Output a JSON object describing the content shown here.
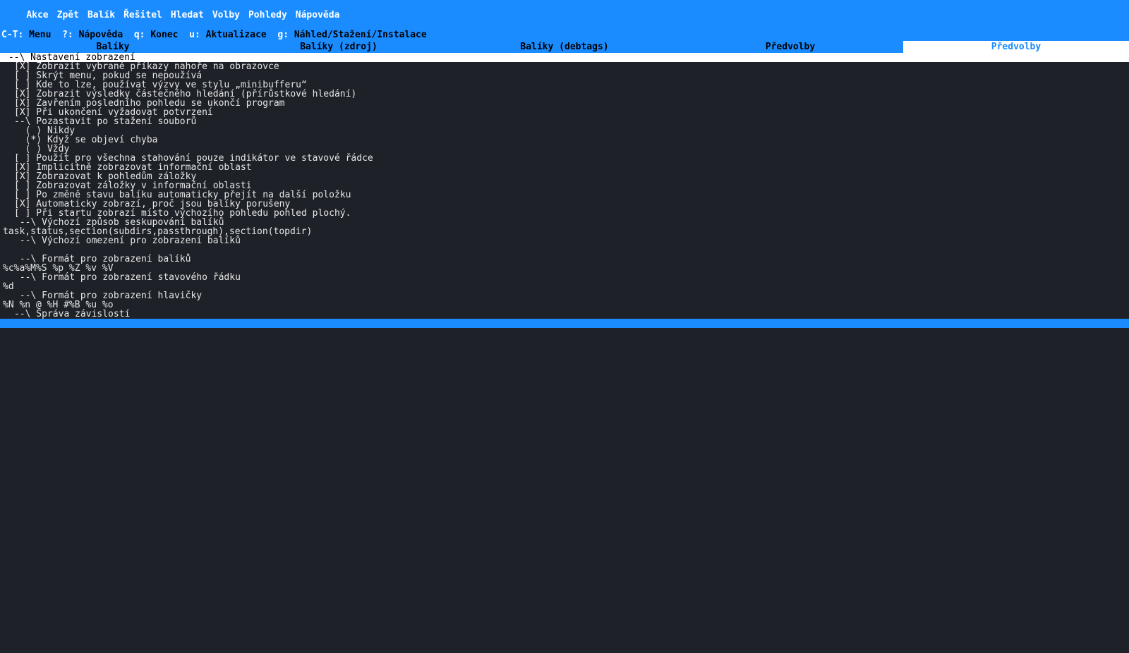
{
  "menubar": {
    "items": [
      "Akce",
      "Zpět",
      "Balík",
      "Řešitel",
      "Hledat",
      "Volby",
      "Pohledy",
      "Nápověda"
    ]
  },
  "shortcuts": {
    "parts": [
      {
        "k": "C-T:",
        "v": "Menu"
      },
      {
        "k": "?:",
        "v": "Nápověda"
      },
      {
        "k": "q:",
        "v": "Konec"
      },
      {
        "k": "u:",
        "v": "Aktualizace"
      },
      {
        "k": "g:",
        "v": "Náhled/Stažení/Instalace"
      }
    ]
  },
  "tabs": [
    {
      "label": "Balíky",
      "active": false
    },
    {
      "label": "Balíky (zdroj)",
      "active": false
    },
    {
      "label": "Balíky (debtags)",
      "active": false
    },
    {
      "label": "Předvolby",
      "active": false
    },
    {
      "label": "Předvolby",
      "active": true
    }
  ],
  "section_header": " --\\ Nastavení zobrazení",
  "lines": [
    {
      "indent": true,
      "text": "[X] Zobrazit vybrané příkazy nahoře na obrazovce"
    },
    {
      "indent": true,
      "text": "[ ] Skrýt menu, pokud se nepoužívá"
    },
    {
      "indent": true,
      "text": "[ ] Kde to lze, používat výzvy ve stylu „minibufferu“"
    },
    {
      "indent": true,
      "text": "[X] Zobrazit výsledky částečného hledání (přírůstkové hledání)"
    },
    {
      "indent": true,
      "text": "[X] Zavřením posledního pohledu se ukončí program"
    },
    {
      "indent": true,
      "text": "[X] Při ukončení vyžadovat potvrzení"
    },
    {
      "indent": true,
      "text": "--\\ Pozastavit po stažení souborů"
    },
    {
      "indent": true,
      "text": "  ( ) Nikdy"
    },
    {
      "indent": true,
      "text": "  (*) Když se objeví chyba"
    },
    {
      "indent": true,
      "text": "  ( ) Vždy"
    },
    {
      "indent": true,
      "text": "[ ] Použít pro všechna stahování pouze indikátor ve stavové řádce"
    },
    {
      "indent": true,
      "text": "[X] Implicitně zobrazovat informační oblast"
    },
    {
      "indent": true,
      "text": "[X] Zobrazovat k pohledům záložky"
    },
    {
      "indent": true,
      "text": "[ ] Zobrazovat záložky v informační oblasti"
    },
    {
      "indent": true,
      "text": "[ ] Po změně stavu balíku automaticky přejít na další položku"
    },
    {
      "indent": true,
      "text": "[X] Automaticky zobrazí, proč jsou balíky porušeny"
    },
    {
      "indent": true,
      "text": "[ ] Při startu zobrazí místo výchozího pohledu pohled plochý."
    },
    {
      "indent": true,
      "text": " --\\ Výchozí způsob seskupování balíků"
    },
    {
      "indent": false,
      "text": "task,status,section(subdirs,passthrough),section(topdir)"
    },
    {
      "indent": true,
      "text": " --\\ Výchozí omezení pro zobrazení balíků"
    },
    {
      "indent": false,
      "text": ""
    },
    {
      "indent": true,
      "text": " --\\ Formát pro zobrazení balíků"
    },
    {
      "indent": false,
      "text": "%c%a%M%S %p %Z %v %V"
    },
    {
      "indent": true,
      "text": " --\\ Formát pro zobrazení stavového řádku"
    },
    {
      "indent": false,
      "text": "%d"
    },
    {
      "indent": true,
      "text": " --\\ Formát pro zobrazení hlavičky"
    },
    {
      "indent": false,
      "text": "%N %n @ %H #%B %u %o"
    },
    {
      "indent": true,
      "text": "--\\ Správa závislostí"
    }
  ]
}
